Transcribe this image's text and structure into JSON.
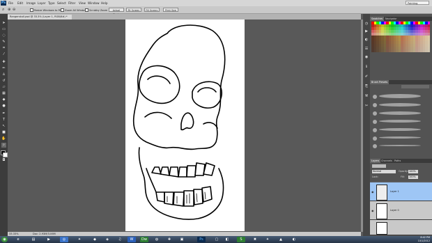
{
  "menubar": {
    "logo": "Ps",
    "items": [
      "File",
      "Edit",
      "Image",
      "Layer",
      "Type",
      "Select",
      "Filter",
      "View",
      "Window",
      "Help"
    ],
    "workspace": "Painting"
  },
  "options_bar": {
    "resize_windows": "Resize Windows to Fit",
    "zoom_all": "Zoom All Windows",
    "scrubby_zoom": "Scrubby Zoom",
    "actual_pixels": "Actual Pixels",
    "fit_screen": "Fit Screen",
    "fill_screen": "Fill Screen",
    "print_size": "Print Size"
  },
  "document": {
    "tab_title": "Rangerskull.psd @ 33.3% (Layer 1, RGB/8#) *",
    "zoom": "33.33%",
    "info": "Doc: 2.93M/3.06M"
  },
  "panels": {
    "swatches": {
      "tabs": [
        "Swatches",
        "Navigator"
      ]
    },
    "brush_presets": {
      "title": "Brush Presets"
    },
    "layers": {
      "tabs": [
        "Layers",
        "Channels",
        "Paths"
      ],
      "kind": "Normal",
      "opacity_label": "Opacity:",
      "opacity": "100%",
      "lock_label": "Lock:",
      "fill_label": "Fill:",
      "fill": "100%",
      "items": [
        {
          "name": "Layer 1",
          "selected": true
        },
        {
          "name": "Layer 0",
          "selected": false
        },
        {
          "name": "",
          "selected": false
        }
      ]
    }
  },
  "taskbar": {
    "time": "8:42 PM",
    "date": "10/1/2012"
  },
  "colors": {
    "accent": "#9ec6f5",
    "menubar": "#d6d6d6",
    "panel": "#535353"
  }
}
